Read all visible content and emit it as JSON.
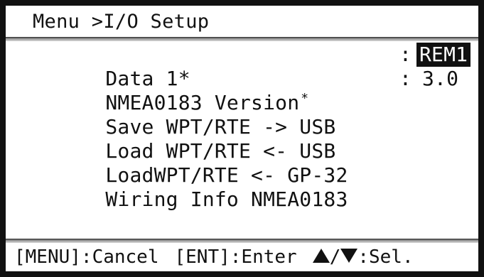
{
  "header": {
    "breadcrumb": "Menu >I/O Setup"
  },
  "menu": {
    "items": [
      {
        "label": "Data 1",
        "marker": "*",
        "colon": ":",
        "value": "REM1",
        "selected": true
      },
      {
        "label": "NMEA0183 Version",
        "marker": "*",
        "colon": ":",
        "value": "3.0",
        "selected": false
      },
      {
        "label": "Save WPT/RTE -> USB"
      },
      {
        "label": "Load WPT/RTE <- USB"
      },
      {
        "label": "LoadWPT/RTE <- GP-32"
      },
      {
        "label": "Wiring Info NMEA0183"
      }
    ]
  },
  "footer": {
    "cancel_hint": "[MENU]:Cancel",
    "enter_hint": "[ENT]:Enter",
    "separator": "/",
    "select_hint": ":Sel.",
    "up_icon": "triangle-up-icon",
    "down_icon": "triangle-down-icon"
  }
}
